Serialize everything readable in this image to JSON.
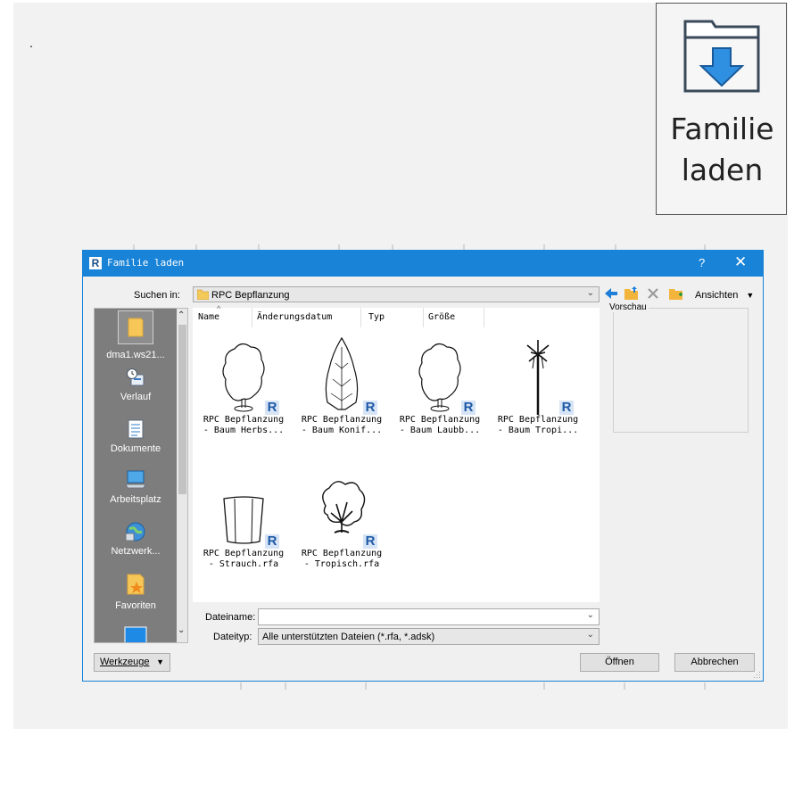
{
  "page": {
    "dot": "."
  },
  "ribbon_button": {
    "label_line1": "Familie",
    "label_line2": "laden"
  },
  "dialog": {
    "title": "Familie laden",
    "help": "?",
    "close": "✕",
    "look_in": {
      "label": "Suchen in:",
      "value": "RPC Bepflanzung"
    },
    "toolbar": {
      "views_label": "Ansichten"
    },
    "columns": [
      "Name",
      "Änderungsdatum",
      "Typ",
      "Größe"
    ],
    "places": [
      {
        "label": "dma1.ws21...",
        "icon": "folder-icon"
      },
      {
        "label": "Verlauf",
        "icon": "history-icon"
      },
      {
        "label": "Dokumente",
        "icon": "documents-icon"
      },
      {
        "label": "Arbeitsplatz",
        "icon": "computer-icon"
      },
      {
        "label": "Netzwerk...",
        "icon": "network-icon"
      },
      {
        "label": "Favoriten",
        "icon": "favorites-icon"
      }
    ],
    "files": [
      {
        "line1": "RPC Bepflanzung",
        "line2": "- Baum Herbs...",
        "thumb": "deciduous-tree"
      },
      {
        "line1": "RPC Bepflanzung",
        "line2": "- Baum Konif...",
        "thumb": "conifer-tree"
      },
      {
        "line1": "RPC Bepflanzung",
        "line2": "- Baum Laubb...",
        "thumb": "deciduous-tree"
      },
      {
        "line1": "RPC Bepflanzung",
        "line2": "- Baum Tropi...",
        "thumb": "palm-tree"
      },
      {
        "line1": "RPC Bepflanzung",
        "line2": "- Strauch.rfa",
        "thumb": "shrub"
      },
      {
        "line1": "RPC Bepflanzung",
        "line2": "- Tropisch.rfa",
        "thumb": "tropical-plant"
      }
    ],
    "preview_label": "Vorschau",
    "filename": {
      "label": "Dateiname:",
      "value": ""
    },
    "filetype": {
      "label": "Dateityp:",
      "value": "Alle unterstützten Dateien  (*.rfa, *.adsk)"
    },
    "tools_label": "Werkzeuge",
    "open_label": "Öffnen",
    "cancel_label": "Abbrechen"
  }
}
